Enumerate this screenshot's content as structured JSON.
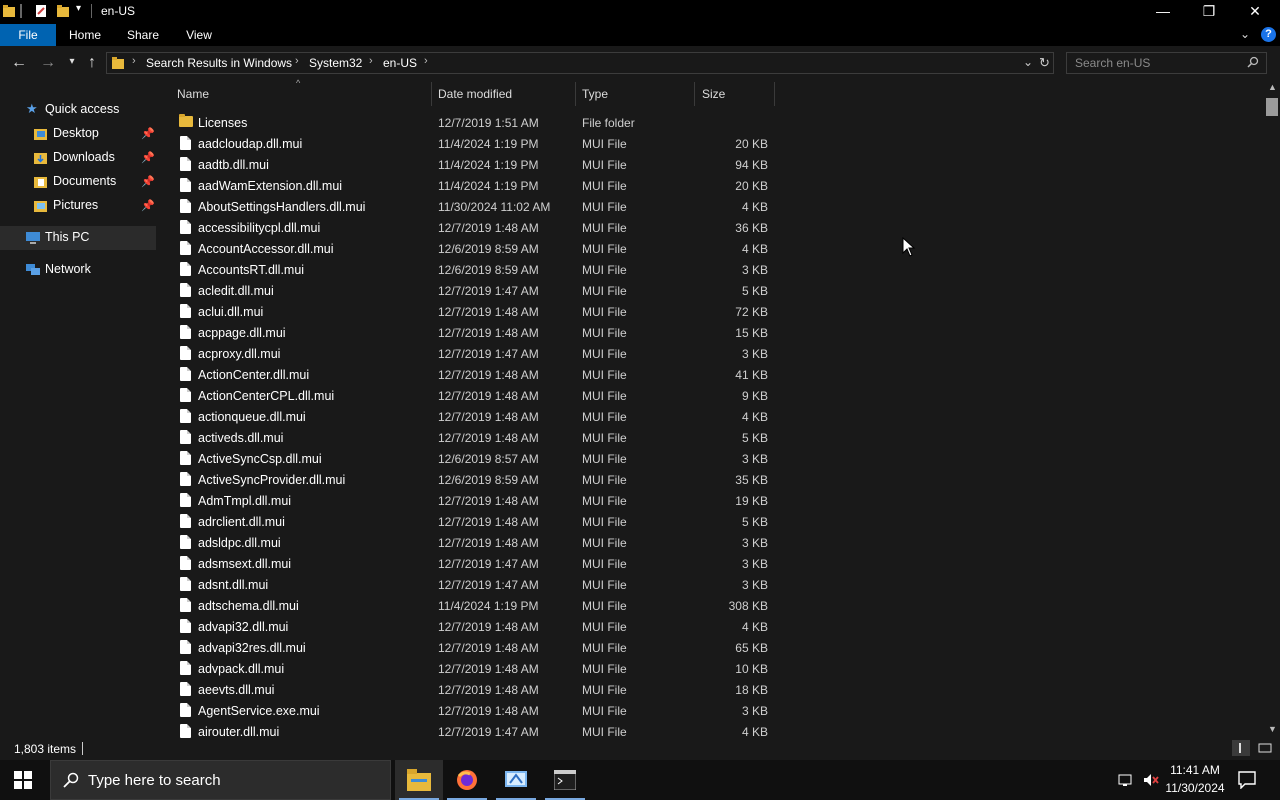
{
  "window": {
    "title": "en-US",
    "minimize_glyph": "—",
    "restore_glyph": "❐",
    "close_glyph": "✕"
  },
  "ribbon": {
    "tabs": [
      "File",
      "Home",
      "Share",
      "View"
    ]
  },
  "address": {
    "breadcrumbs": [
      "Search Results in Windows",
      "System32",
      "en-US"
    ],
    "search_placeholder": "Search en-US"
  },
  "nav": {
    "quick_access": "Quick access",
    "items": [
      "Desktop",
      "Downloads",
      "Documents",
      "Pictures"
    ],
    "this_pc": "This PC",
    "network": "Network"
  },
  "columns": {
    "name": "Name",
    "date": "Date modified",
    "type": "Type",
    "size": "Size"
  },
  "files": [
    {
      "name": "Licenses",
      "date": "12/7/2019 1:51 AM",
      "type": "File folder",
      "size": "",
      "folder": true
    },
    {
      "name": "aadcloudap.dll.mui",
      "date": "11/4/2024 1:19 PM",
      "type": "MUI File",
      "size": "20 KB"
    },
    {
      "name": "aadtb.dll.mui",
      "date": "11/4/2024 1:19 PM",
      "type": "MUI File",
      "size": "94 KB"
    },
    {
      "name": "aadWamExtension.dll.mui",
      "date": "11/4/2024 1:19 PM",
      "type": "MUI File",
      "size": "20 KB"
    },
    {
      "name": "AboutSettingsHandlers.dll.mui",
      "date": "11/30/2024 11:02 AM",
      "type": "MUI File",
      "size": "4 KB"
    },
    {
      "name": "accessibilitycpl.dll.mui",
      "date": "12/7/2019 1:48 AM",
      "type": "MUI File",
      "size": "36 KB"
    },
    {
      "name": "AccountAccessor.dll.mui",
      "date": "12/6/2019 8:59 AM",
      "type": "MUI File",
      "size": "4 KB"
    },
    {
      "name": "AccountsRT.dll.mui",
      "date": "12/6/2019 8:59 AM",
      "type": "MUI File",
      "size": "3 KB"
    },
    {
      "name": "acledit.dll.mui",
      "date": "12/7/2019 1:47 AM",
      "type": "MUI File",
      "size": "5 KB"
    },
    {
      "name": "aclui.dll.mui",
      "date": "12/7/2019 1:48 AM",
      "type": "MUI File",
      "size": "72 KB"
    },
    {
      "name": "acppage.dll.mui",
      "date": "12/7/2019 1:48 AM",
      "type": "MUI File",
      "size": "15 KB"
    },
    {
      "name": "acproxy.dll.mui",
      "date": "12/7/2019 1:47 AM",
      "type": "MUI File",
      "size": "3 KB"
    },
    {
      "name": "ActionCenter.dll.mui",
      "date": "12/7/2019 1:48 AM",
      "type": "MUI File",
      "size": "41 KB"
    },
    {
      "name": "ActionCenterCPL.dll.mui",
      "date": "12/7/2019 1:48 AM",
      "type": "MUI File",
      "size": "9 KB"
    },
    {
      "name": "actionqueue.dll.mui",
      "date": "12/7/2019 1:48 AM",
      "type": "MUI File",
      "size": "4 KB"
    },
    {
      "name": "activeds.dll.mui",
      "date": "12/7/2019 1:48 AM",
      "type": "MUI File",
      "size": "5 KB"
    },
    {
      "name": "ActiveSyncCsp.dll.mui",
      "date": "12/6/2019 8:57 AM",
      "type": "MUI File",
      "size": "3 KB"
    },
    {
      "name": "ActiveSyncProvider.dll.mui",
      "date": "12/6/2019 8:59 AM",
      "type": "MUI File",
      "size": "35 KB"
    },
    {
      "name": "AdmTmpl.dll.mui",
      "date": "12/7/2019 1:48 AM",
      "type": "MUI File",
      "size": "19 KB"
    },
    {
      "name": "adrclient.dll.mui",
      "date": "12/7/2019 1:48 AM",
      "type": "MUI File",
      "size": "5 KB"
    },
    {
      "name": "adsldpc.dll.mui",
      "date": "12/7/2019 1:48 AM",
      "type": "MUI File",
      "size": "3 KB"
    },
    {
      "name": "adsmsext.dll.mui",
      "date": "12/7/2019 1:47 AM",
      "type": "MUI File",
      "size": "3 KB"
    },
    {
      "name": "adsnt.dll.mui",
      "date": "12/7/2019 1:47 AM",
      "type": "MUI File",
      "size": "3 KB"
    },
    {
      "name": "adtschema.dll.mui",
      "date": "11/4/2024 1:19 PM",
      "type": "MUI File",
      "size": "308 KB"
    },
    {
      "name": "advapi32.dll.mui",
      "date": "12/7/2019 1:48 AM",
      "type": "MUI File",
      "size": "4 KB"
    },
    {
      "name": "advapi32res.dll.mui",
      "date": "12/7/2019 1:48 AM",
      "type": "MUI File",
      "size": "65 KB"
    },
    {
      "name": "advpack.dll.mui",
      "date": "12/7/2019 1:48 AM",
      "type": "MUI File",
      "size": "10 KB"
    },
    {
      "name": "aeevts.dll.mui",
      "date": "12/7/2019 1:48 AM",
      "type": "MUI File",
      "size": "18 KB"
    },
    {
      "name": "AgentService.exe.mui",
      "date": "12/7/2019 1:48 AM",
      "type": "MUI File",
      "size": "3 KB"
    },
    {
      "name": "airouter.dll.mui",
      "date": "12/7/2019 1:47 AM",
      "type": "MUI File",
      "size": "4 KB"
    }
  ],
  "status": {
    "item_count": "1,803 items"
  },
  "taskbar": {
    "search_placeholder": "Type here to search",
    "time": "11:41 AM",
    "date": "11/30/2024",
    "apps": [
      "file-explorer",
      "firefox",
      "control-panel",
      "terminal"
    ]
  },
  "colors": {
    "accent": "#0063b1",
    "folder": "#e8b93c",
    "background": "#191919"
  }
}
